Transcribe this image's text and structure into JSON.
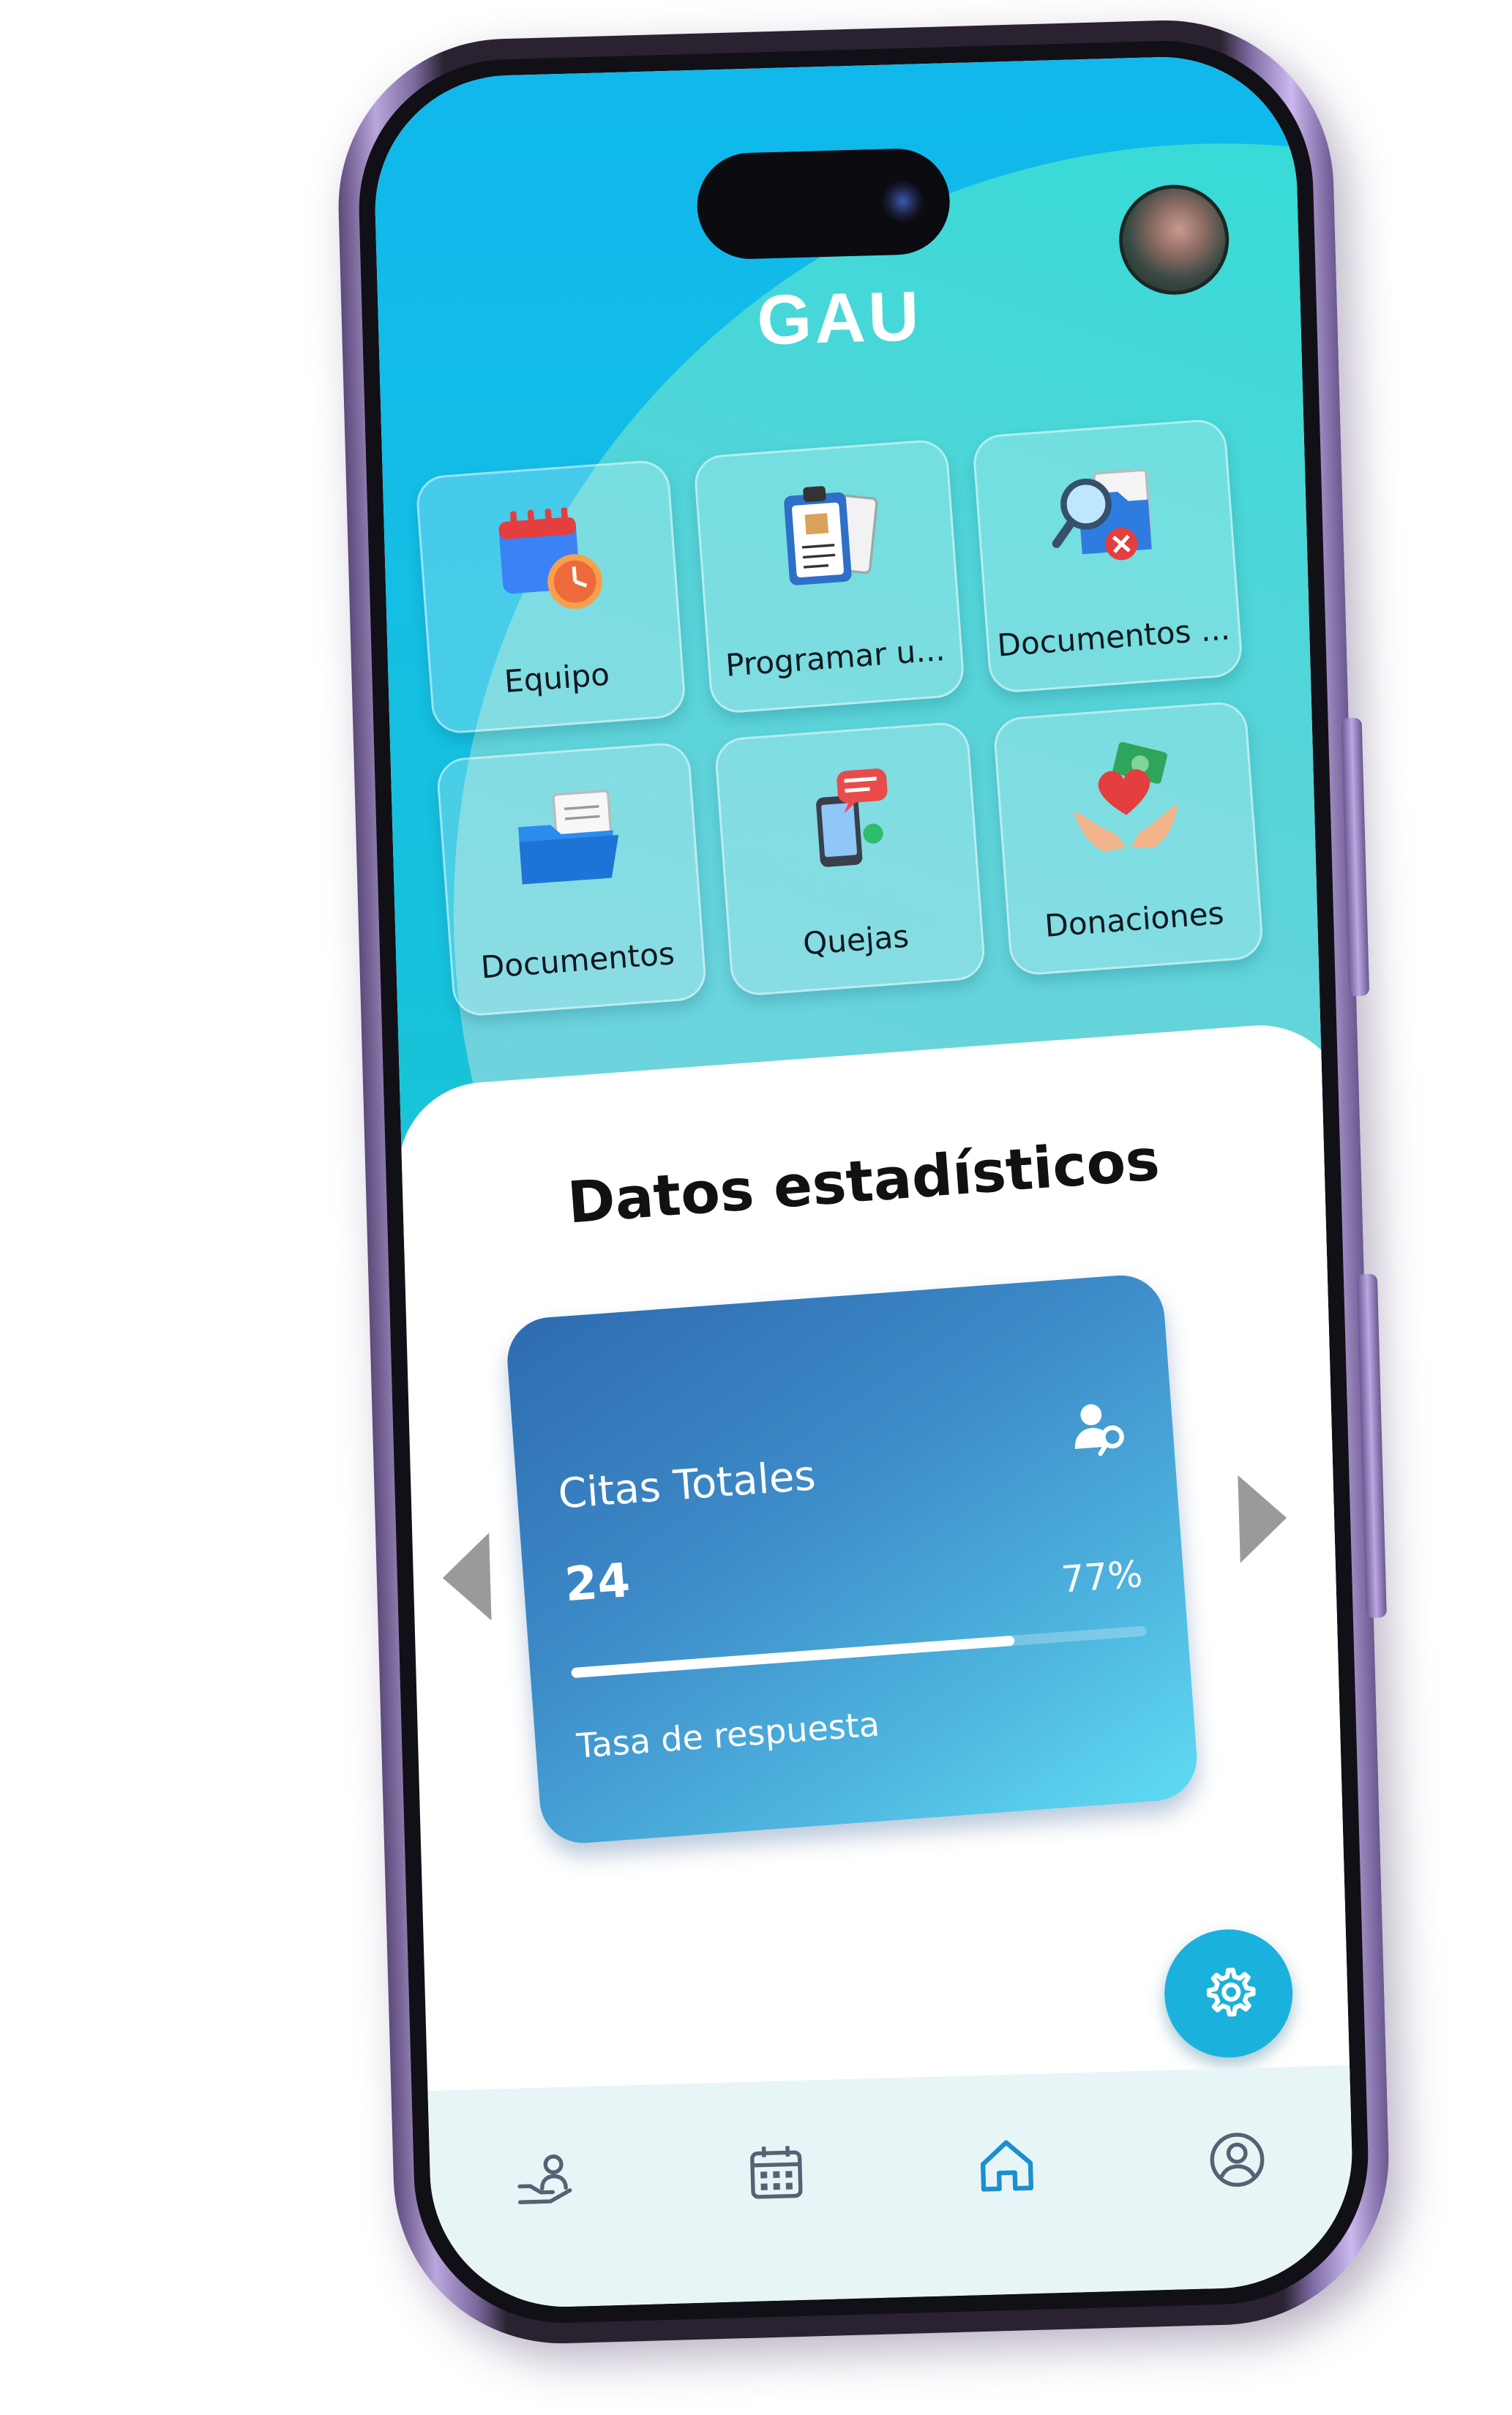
{
  "app": {
    "title": "GAU"
  },
  "menu": {
    "tiles": [
      {
        "label": "Equipo",
        "icon": "calendar-clock-icon"
      },
      {
        "label": "Programar u...",
        "icon": "clipboard-documents-icon"
      },
      {
        "label": "Documentos ...",
        "icon": "document-search-icon"
      },
      {
        "label": "Documentos",
        "icon": "folder-icon"
      },
      {
        "label": "Quejas",
        "icon": "phone-message-icon"
      },
      {
        "label": "Donaciones",
        "icon": "hands-heart-money-icon"
      }
    ]
  },
  "stats": {
    "section_title": "Datos estadísticos",
    "card": {
      "label": "Citas Totales",
      "value": "24",
      "percent_text": "77%",
      "progress": 0.77,
      "subtitle": "Tasa de respuesta",
      "icon": "user-key-icon"
    }
  },
  "fab": {
    "icon": "gear-icon"
  },
  "bottom_nav": {
    "items": [
      {
        "icon": "hand-user-icon"
      },
      {
        "icon": "calendar-icon"
      },
      {
        "icon": "home-icon",
        "active": true
      },
      {
        "icon": "profile-icon"
      }
    ]
  },
  "colors": {
    "header_primary": "#10b8ec",
    "header_accent": "#2fe5d2",
    "card_start": "#2e6bb0",
    "card_end": "#60dcf3",
    "fab": "#1ab2dc",
    "nav_active": "#1a8fd1",
    "nav_inactive": "#566273",
    "phone_frame": "#b9a6dc"
  }
}
